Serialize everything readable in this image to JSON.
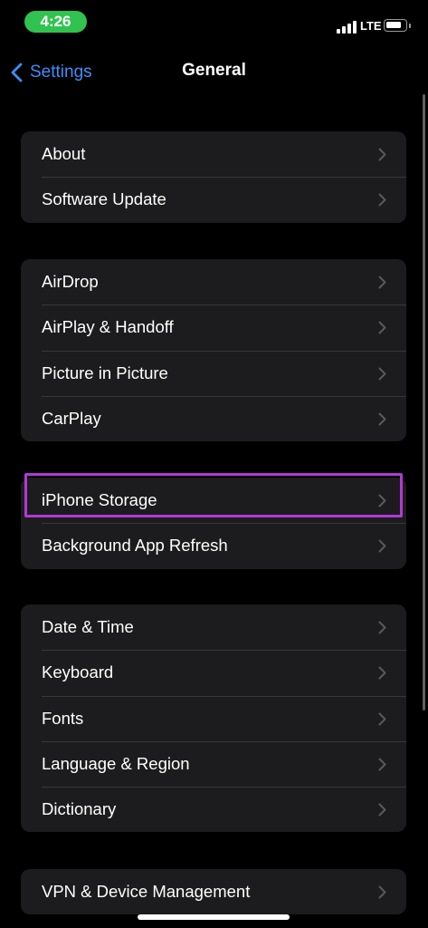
{
  "status_bar": {
    "time": "4:26",
    "network": "LTE",
    "icons": [
      "signal-icon",
      "battery-icon"
    ],
    "time_pill_color": "#30c34f"
  },
  "nav": {
    "back_label": "Settings",
    "title": "General",
    "accent_color": "#3e8ff8"
  },
  "groups": [
    {
      "items": [
        {
          "label": "About"
        },
        {
          "label": "Software Update"
        }
      ]
    },
    {
      "items": [
        {
          "label": "AirDrop"
        },
        {
          "label": "AirPlay & Handoff"
        },
        {
          "label": "Picture in Picture"
        },
        {
          "label": "CarPlay"
        }
      ]
    },
    {
      "items": [
        {
          "label": "iPhone Storage",
          "highlighted": true
        },
        {
          "label": "Background App Refresh"
        }
      ]
    },
    {
      "items": [
        {
          "label": "Date & Time"
        },
        {
          "label": "Keyboard"
        },
        {
          "label": "Fonts"
        },
        {
          "label": "Language & Region"
        },
        {
          "label": "Dictionary"
        }
      ]
    },
    {
      "items": [
        {
          "label": "VPN & Device Management"
        }
      ]
    }
  ],
  "highlight_color": "#b03ad6",
  "chevron_icon": "chevron-right-icon"
}
